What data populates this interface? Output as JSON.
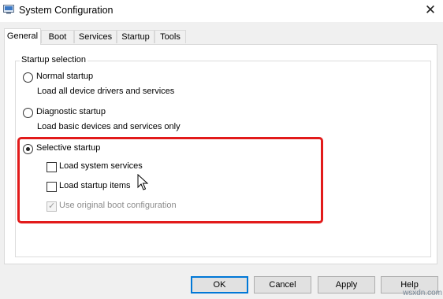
{
  "window": {
    "title": "System Configuration",
    "close_glyph": "✕",
    "icon": "msconfig-icon"
  },
  "tabs": [
    {
      "label": "General",
      "active": true
    },
    {
      "label": "Boot",
      "active": false
    },
    {
      "label": "Services",
      "active": false
    },
    {
      "label": "Startup",
      "active": false
    },
    {
      "label": "Tools",
      "active": false
    }
  ],
  "startup_selection": {
    "legend": "Startup selection",
    "normal": {
      "label": "Normal startup",
      "description": "Load all device drivers and services",
      "selected": false
    },
    "diagnostic": {
      "label": "Diagnostic startup",
      "description": "Load basic devices and services only",
      "selected": false
    },
    "selective": {
      "label": "Selective startup",
      "selected": true,
      "options": [
        {
          "label": "Load system services",
          "checked": false,
          "enabled": true
        },
        {
          "label": "Load startup items",
          "checked": false,
          "enabled": true
        },
        {
          "label": "Use original boot configuration",
          "checked": true,
          "enabled": false
        }
      ]
    }
  },
  "buttons": {
    "ok": "OK",
    "cancel": "Cancel",
    "apply": "Apply",
    "help": "Help"
  },
  "watermark": "wsxdn.com",
  "colors": {
    "highlight": "#e21b1b",
    "default_button_border": "#0078d7"
  }
}
